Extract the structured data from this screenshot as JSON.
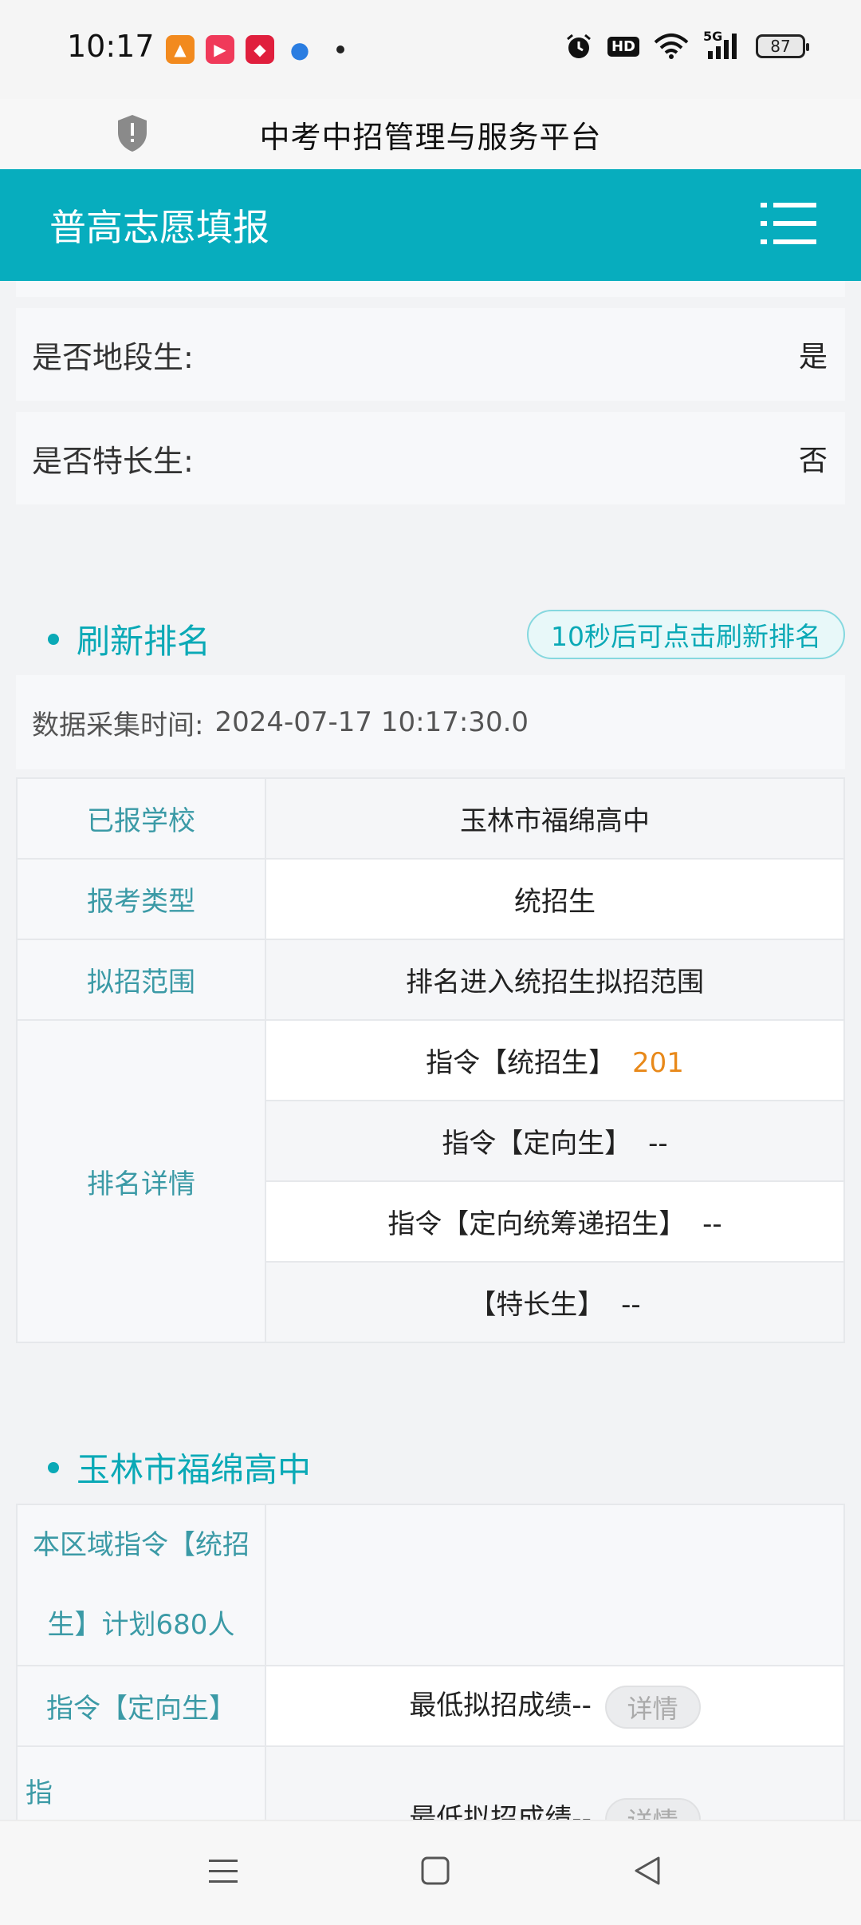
{
  "status_bar": {
    "time": "10:17",
    "battery": "87",
    "network": "5G",
    "hd": "HD"
  },
  "browser": {
    "title": "中考中招管理与服务平台"
  },
  "header": {
    "title": "普高志愿填报"
  },
  "info_rows": [
    {
      "label": "是否地段生:",
      "value": "是"
    },
    {
      "label": "是否特长生:",
      "value": "否"
    }
  ],
  "ranking": {
    "section_title": "刷新排名",
    "refresh_button": "10秒后可点击刷新排名",
    "collect_label": "数据采集时间:",
    "collect_time": "2024-07-17 10:17:30.0",
    "rows": [
      {
        "label": "已报学校",
        "value": "玉林市福绵高中"
      },
      {
        "label": "报考类型",
        "value": "统招生"
      },
      {
        "label": "拟招范围",
        "value": "排名进入统招生拟招范围"
      }
    ],
    "detail_label": "排名详情",
    "details": [
      {
        "text": "指令【统招生】",
        "value": "201"
      },
      {
        "text": "指令【定向生】",
        "value": "--"
      },
      {
        "text": "指令【定向统筹递招生】",
        "value": "--"
      },
      {
        "text": "【特长生】",
        "value": "--"
      }
    ]
  },
  "school": {
    "section_title": "玉林市福绵高中",
    "row1_label": "本区域指令【统招生】计划680人",
    "row2_label": "指令【定向生】",
    "row2_value": "最低拟招成绩--",
    "detail_button": "详情",
    "row3_label": "指",
    "row3_value": "最低拟招成绩--"
  },
  "colors": {
    "accent": "#07adbe",
    "highlight": "#e8891a"
  }
}
